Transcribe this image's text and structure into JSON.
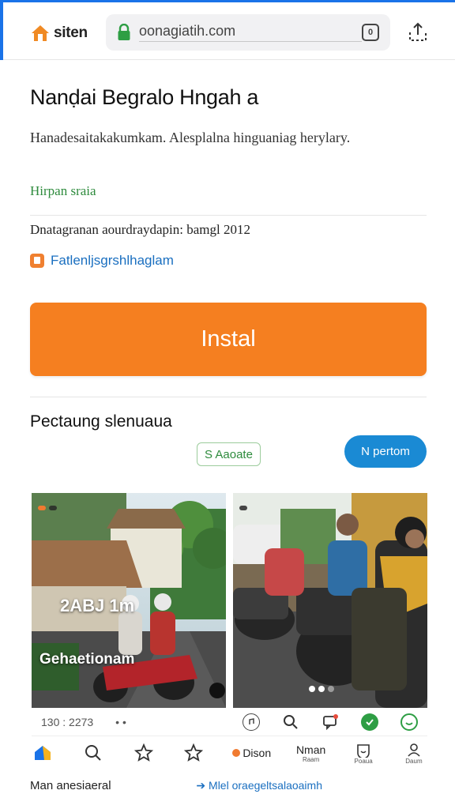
{
  "browser": {
    "brand_label": "siten",
    "url": "oonagiatih.com",
    "tab_count": "0"
  },
  "app": {
    "title": "Nanḍai Begralo Hngah a",
    "description": "Hanadesaitakakumkam. Alesplalna hinguaniag herylary.",
    "developer": "Hirpan sraia",
    "meta": "Dnatagranan aourdraydapin: bamgl 2012",
    "link_text": "Fatlenljsgrshlhaglam",
    "install_label": "Instal"
  },
  "section": {
    "title": "Pectaung slenuaua",
    "chip_label": "S Aaoate",
    "pill_label": "N pertom"
  },
  "screenshots": [
    {
      "badge_orange": "",
      "badge_dark": "",
      "big_text": "2ABJ  1m",
      "sub_text": "Gehaetionam"
    },
    {
      "badge_orange": "",
      "badge_dark": ""
    }
  ],
  "caption": {
    "left_value": "130 : 2273",
    "left_dots": "• •"
  },
  "bottom_nav": [
    {
      "label": "",
      "icon": "home-icon"
    },
    {
      "label": "",
      "icon": "search-icon"
    },
    {
      "label": "",
      "icon": "star-icon"
    },
    {
      "label": "",
      "icon": "star-outline-icon"
    },
    {
      "label": "Dison",
      "icon": "bell-icon"
    },
    {
      "label": "Nman",
      "sub": "Raam",
      "icon": "none"
    },
    {
      "label": "",
      "sub": "Poaua",
      "icon": "smile-icon"
    },
    {
      "label": "",
      "sub": "Daum",
      "icon": "user-icon"
    }
  ],
  "footer": {
    "left": "Man anesiaeral",
    "right": "➔ Mlel oraegeltsalaoaimh"
  },
  "colors": {
    "accent_blue": "#1a73e8",
    "install_orange": "#f57f20",
    "developer_green": "#2e8b3d",
    "link_blue": "#1a6fc0",
    "pill_blue": "#1a8ad4"
  }
}
